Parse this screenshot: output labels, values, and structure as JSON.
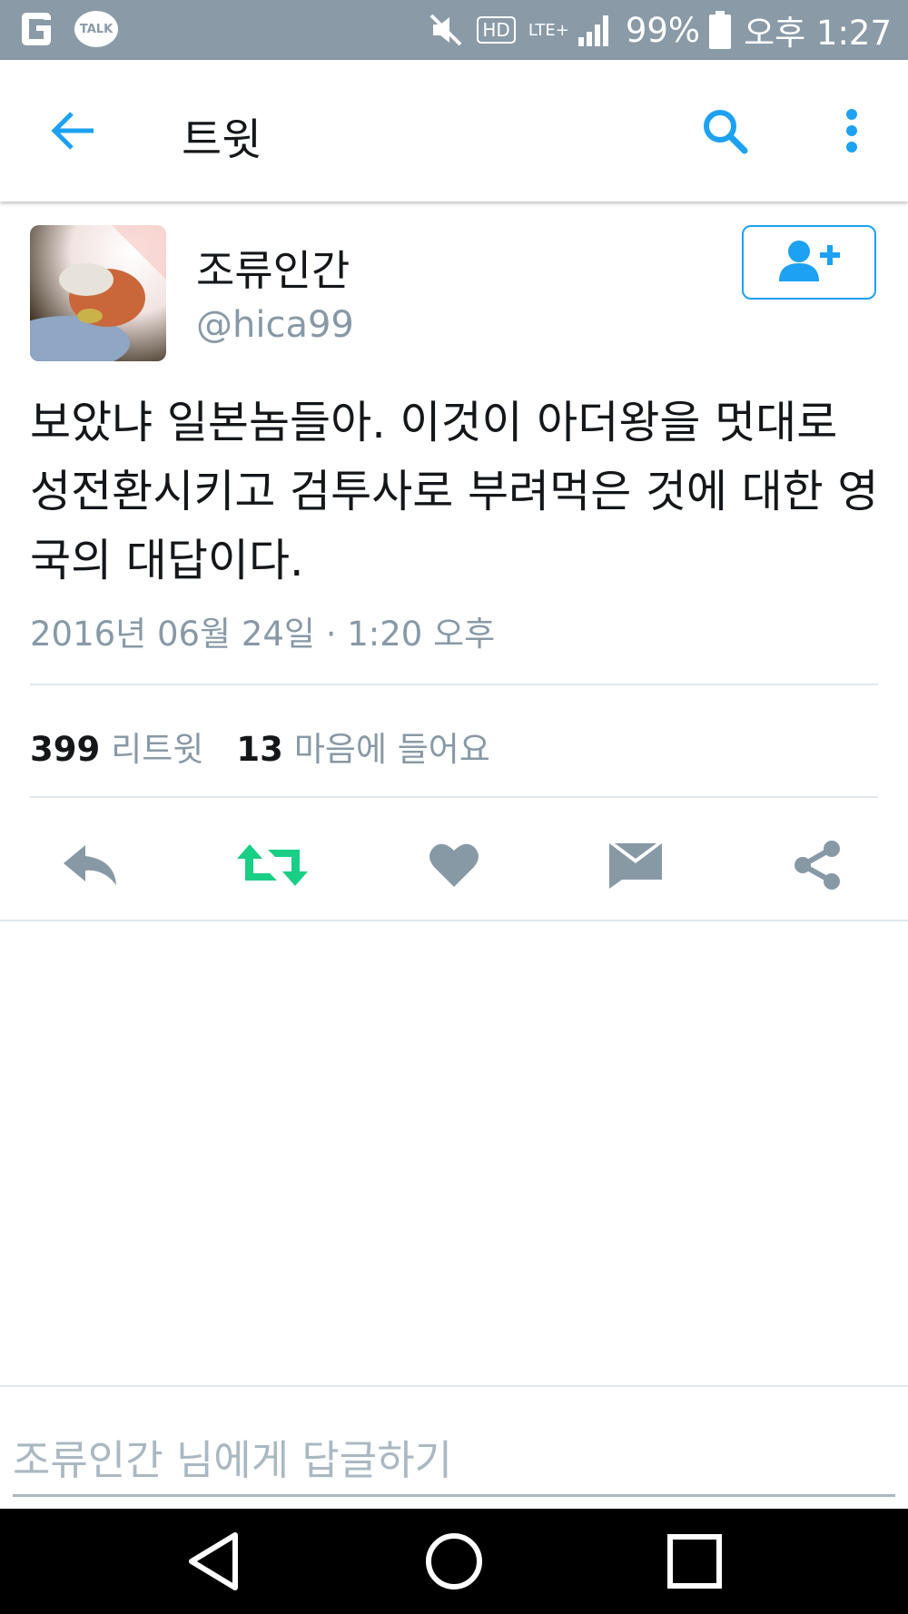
{
  "status_bar": {
    "kakao_label": "TALK",
    "hd_label": "HD",
    "network_label": "LTE+",
    "battery_percent": "99%",
    "time": "오후 1:27"
  },
  "app_bar": {
    "title": "트윗"
  },
  "tweet": {
    "display_name": "조류인간",
    "handle": "@hica99",
    "text": "보았냐 일본놈들아. 이것이 아더왕을 멋대로 성전환시키고 검투사로 부려먹은 것에 대한 영국의 대답이다.",
    "timestamp": "2016년 06월 24일 · 1:20 오후",
    "retweet_count": "399",
    "retweet_label": "리트윗",
    "like_count": "13",
    "like_label": "마음에 들어요"
  },
  "reply": {
    "placeholder": "조류인간 님에게 답글하기"
  },
  "colors": {
    "accent": "#1da1f2",
    "retweet_active": "#19cf86",
    "icon_gray": "#8899a6",
    "status_bar": "#8a9aa7"
  },
  "icons": [
    "back-arrow-icon",
    "search-icon",
    "more-vertical-icon",
    "follow-user-icon",
    "reply-icon",
    "retweet-icon",
    "heart-icon",
    "envelope-icon",
    "share-icon"
  ]
}
